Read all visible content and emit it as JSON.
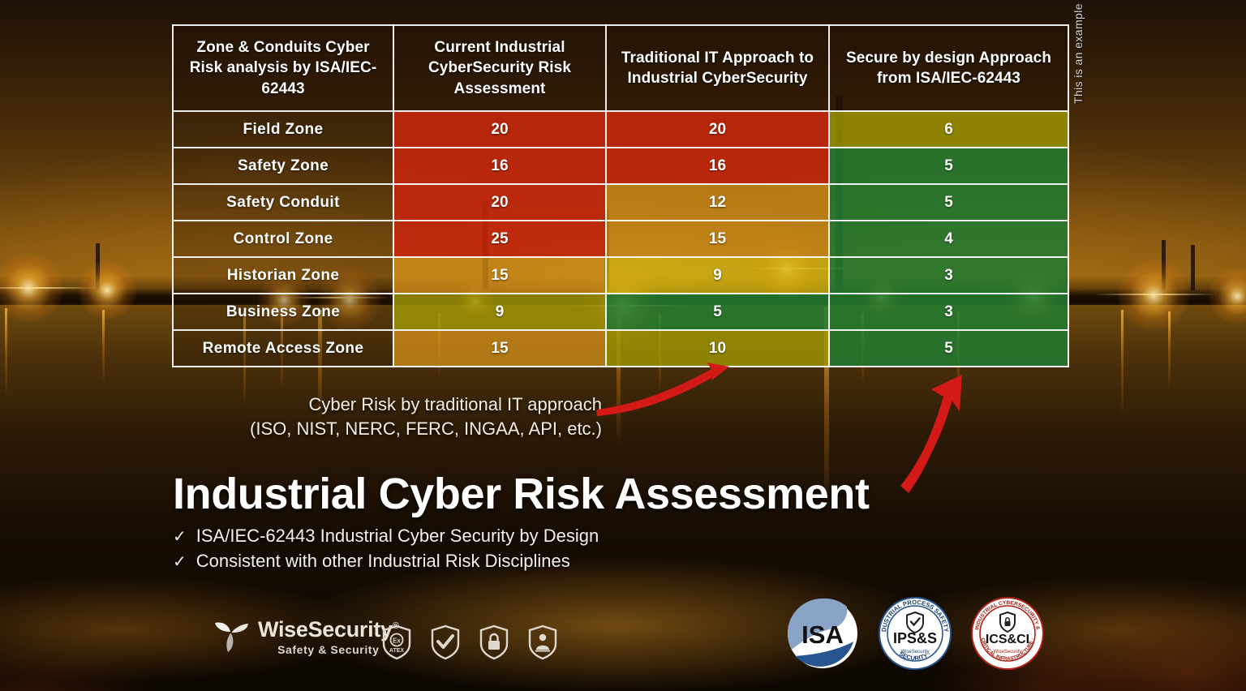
{
  "table": {
    "headers": [
      "Zone & Conduits Cyber Risk analysis by ISA/IEC-62443",
      "Current Industrial CyberSecurity Risk Assessment",
      "Traditional IT Approach to Industrial CyberSecurity",
      "Secure by design Approach from ISA/IEC-62443"
    ],
    "rows": [
      {
        "zone": "Field Zone",
        "current": "20",
        "traditional": "20",
        "secure": "6",
        "current_color": "c-red",
        "traditional_color": "c-red",
        "secure_color": "c-olive"
      },
      {
        "zone": "Safety Zone",
        "current": "16",
        "traditional": "16",
        "secure": "5",
        "current_color": "c-red",
        "traditional_color": "c-red",
        "secure_color": "c-green"
      },
      {
        "zone": "Safety Conduit",
        "current": "20",
        "traditional": "12",
        "secure": "5",
        "current_color": "c-red",
        "traditional_color": "c-orange",
        "secure_color": "c-green"
      },
      {
        "zone": "Control Zone",
        "current": "25",
        "traditional": "15",
        "secure": "4",
        "current_color": "c-red",
        "traditional_color": "c-orange",
        "secure_color": "c-green"
      },
      {
        "zone": "Historian Zone",
        "current": "15",
        "traditional": "9",
        "secure": "3",
        "current_color": "c-orange",
        "traditional_color": "c-yellow",
        "secure_color": "c-green"
      },
      {
        "zone": "Business Zone",
        "current": "9",
        "traditional": "5",
        "secure": "3",
        "current_color": "c-olive",
        "traditional_color": "c-green",
        "secure_color": "c-green"
      },
      {
        "zone": "Remote Access Zone",
        "current": "15",
        "traditional": "10",
        "secure": "5",
        "current_color": "c-orange",
        "traditional_color": "c-olive",
        "secure_color": "c-green"
      }
    ]
  },
  "side_note": "This is an example  of a real risk calculation",
  "caption": {
    "line1": "Cyber Risk by traditional IT approach",
    "line2": "(ISO, NIST, NERC, FERC, INGAA, API, etc.)"
  },
  "headline": "Industrial Cyber Risk Assessment",
  "bullets": [
    {
      "check": "✓",
      "text": "ISA/IEC-62443 Industrial  Cyber Security by Design"
    },
    {
      "check": "✓",
      "text": "Consistent with other Industrial  Risk Disciplines"
    }
  ],
  "brand": {
    "name": "WiseSecurity",
    "registered": "®",
    "tagline": "Safety & Security"
  },
  "cert_icons": [
    {
      "name": "atex-shield-icon",
      "label": "ATEX"
    },
    {
      "name": "check-shield-icon",
      "label": "✓"
    },
    {
      "name": "lock-shield-icon",
      "label": "lock"
    },
    {
      "name": "hazmat-shield-icon",
      "label": "hazmat"
    }
  ],
  "badges": [
    {
      "name": "isa-badge",
      "text": "ISA"
    },
    {
      "name": "ipss-badge",
      "text": "IPS&S",
      "ring": "INDUSTRIAL PROCESS SAFETY & SECURITY",
      "sub": "WiseSecurity"
    },
    {
      "name": "icsci-badge",
      "text": "ICS&CI",
      "ring": "INDUSTRIAL CYBERSECURITY & CRITICAL INFRASTRUCTURE",
      "sub": "WiseSecurity"
    }
  ],
  "colors": {
    "red": "#C2260C",
    "orange": "#C98A18",
    "yellow": "#CEB210",
    "olive": "#9A9205",
    "green": "#227A30",
    "arrow_red": "#D41A16",
    "isa_blue": "#26558F",
    "ics_red": "#B02014"
  }
}
